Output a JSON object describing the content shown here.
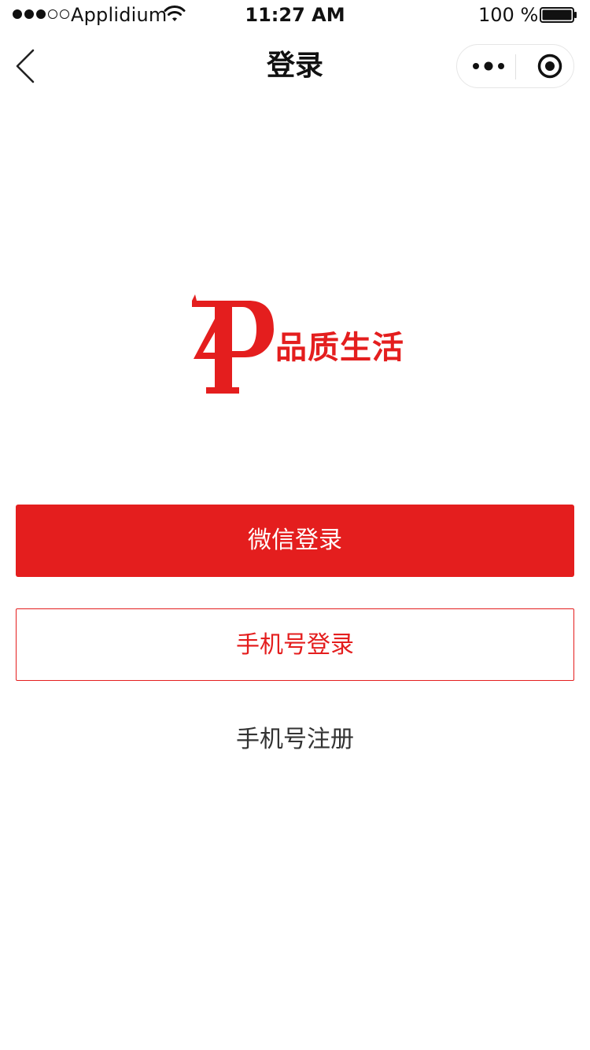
{
  "status_bar": {
    "carrier": "Applidium",
    "time": "11:27 AM",
    "battery_percent": "100 %",
    "signal_bars_filled": 3,
    "signal_bars_total": 5
  },
  "nav": {
    "title": "登录"
  },
  "logo": {
    "text": "品质生活",
    "color": "#e41e1e"
  },
  "actions": {
    "wechat_login_label": "微信登录",
    "phone_login_label": "手机号登录",
    "phone_register_label": "手机号注册"
  },
  "colors": {
    "accent": "#e41e1e",
    "text": "#111111",
    "secondary_text": "#333333"
  },
  "icons": {
    "back": "chevron-left-icon",
    "more": "more-dots-icon",
    "close": "target-circle-icon",
    "wifi": "wifi-icon",
    "battery": "battery-icon"
  }
}
